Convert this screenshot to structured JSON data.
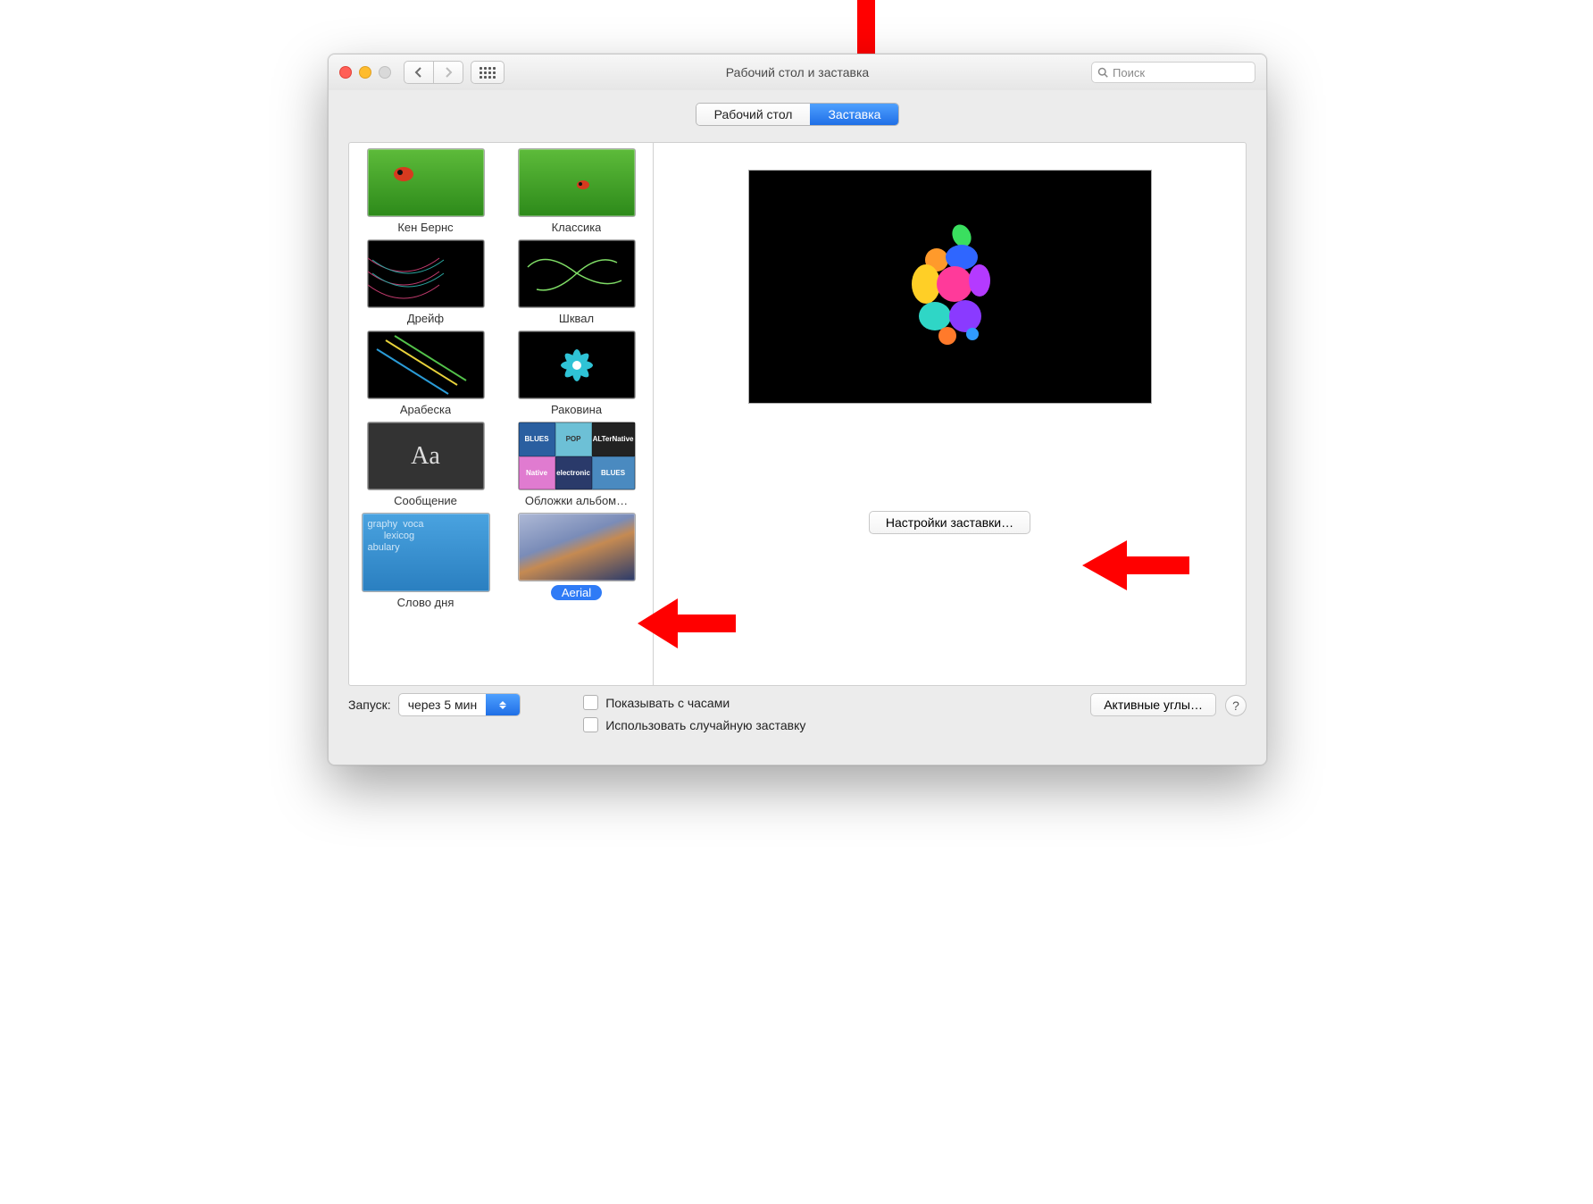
{
  "window": {
    "title": "Рабочий стол и заставка"
  },
  "search": {
    "placeholder": "Поиск"
  },
  "tabs": {
    "desktop": "Рабочий стол",
    "screensaver": "Заставка"
  },
  "savers": [
    {
      "label": "Кен Бернс",
      "thumb": "green-ladybug",
      "selected": false
    },
    {
      "label": "Классика",
      "thumb": "green-ladybug-small",
      "selected": false
    },
    {
      "label": "Дрейф",
      "thumb": "drift",
      "selected": false
    },
    {
      "label": "Шквал",
      "thumb": "flurry",
      "selected": false
    },
    {
      "label": "Арабеска",
      "thumb": "arabesque",
      "selected": false
    },
    {
      "label": "Раковина",
      "thumb": "shell",
      "selected": false
    },
    {
      "label": "Сообщение",
      "thumb": "aa",
      "selected": false
    },
    {
      "label": "Обложки альбом…",
      "thumb": "collage",
      "selected": false
    },
    {
      "label": "Слово дня",
      "thumb": "word",
      "selected": false
    },
    {
      "label": "Aerial",
      "thumb": "aerial",
      "selected": true
    }
  ],
  "preview": {
    "options_button": "Настройки заставки…"
  },
  "footer": {
    "start_label": "Запуск:",
    "start_value": "через 5 мин",
    "show_clock": "Показывать с часами",
    "random_saver": "Использовать случайную заставку",
    "hot_corners": "Активные углы…",
    "help": "?"
  }
}
